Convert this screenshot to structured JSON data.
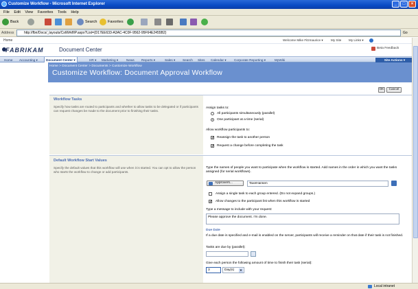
{
  "window": {
    "title": "Customize Workflow - Microsoft Internet Explorer",
    "controls": {
      "minimize": "_",
      "maximize": "□",
      "close": "×"
    }
  },
  "menu": [
    "File",
    "Edit",
    "View",
    "Favorites",
    "Tools",
    "Help"
  ],
  "toolbar": {
    "back": "Back",
    "search": "Search",
    "favorites": "Favorites"
  },
  "address": {
    "label": "Address",
    "url": "http://fbn/Docs/_layouts/CstWrkflIP.aspx?List={D17EE633-A3AC-4C0F-9562-95F64E2455B2}",
    "go": "Go",
    "links": "Links"
  },
  "sharepoint": {
    "home_link": "Home",
    "welcome": "Welcome Mike Fitzmaurice ▾",
    "my_site": "My Site",
    "my_links": "My Links ▾",
    "help_icon": "help-icon",
    "brand": "FABRIKAM",
    "site_name": "Document Center",
    "search_scope": "Beta Feedback",
    "nav": [
      "Home",
      "Accounting ▾",
      "Document Center ▾",
      "HR ▾",
      "Marketing ▾",
      "News",
      "Reports ▾",
      "Sales ▾",
      "Search",
      "Sites",
      "Calendar ▾",
      "Corporate Reporting ▾",
      "MyWiki"
    ],
    "site_actions": "Site Actions ▾",
    "breadcrumb": "Home > Document Center > Documents > Customize Workflow",
    "page_title": "Customize Workflow: Document Approval Workflow"
  },
  "form": {
    "ok": "OK",
    "cancel": "Cancel",
    "tasks": {
      "header": "Workflow Tasks",
      "desc": "Specify how tasks are routed to participants and whether to allow tasks to be delegated or if participants can request changes be made to the document prior to finishing their tasks.",
      "assign_label": "Assign tasks to:",
      "opt_parallel": "All participants simultaneously (parallel)",
      "opt_serial": "One participant at a time (serial)",
      "allow_label": "Allow workflow participants to:",
      "chk_reassign": "Reassign the task to another person",
      "chk_request": "Request a change before completing the task"
    },
    "defaults": {
      "header": "Default Workflow Start Values",
      "desc": "Specify the default values that this workflow will use when it is started. You can opt to allow the person who starts the workflow to change or add participants.",
      "instr": "Type the names of people you want to participate when the workflow is started.  Add names in the order in which you want the tasks assigned (for serial workflows).",
      "approvers_btn": "Approvers...",
      "approvers_value": "TaxeHansen",
      "chk_single": "Assign a single task to each group entered. (Do not expand groups.)",
      "chk_allow": "Allow changes to the participant list when this workflow is started",
      "message_label": "Type a message to include with your request:",
      "message_value": "Please approve the document. I'm done.",
      "due_header": "Due Date",
      "due_desc": "If a due date is specified and e-mail is enabled on the server, participants will receive a reminder on that date if their task is not finished.",
      "due_label": "Tasks are due by (parallel):",
      "duration_label": "Give each person the following amount of time to finish their task (serial):",
      "duration_value": "3",
      "duration_unit": "Day(s)"
    }
  },
  "status": {
    "zone": "Local intranet"
  }
}
